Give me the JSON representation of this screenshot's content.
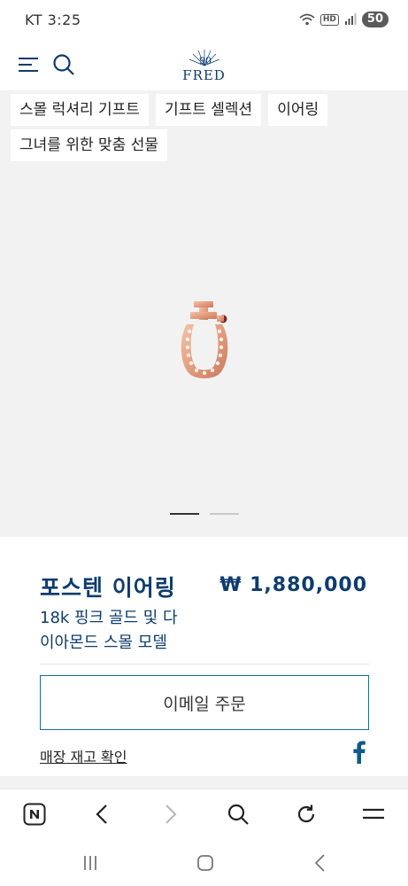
{
  "status_bar": {
    "time": "KT 3:25",
    "network_label": "HD",
    "battery": "50"
  },
  "header": {
    "logo_text": "FRED",
    "logo_mark": "90"
  },
  "tags": [
    "스몰 럭셔리 기프트",
    "기프트 셀렉션",
    "이어링",
    "그녀를 위한 맞춤 선물"
  ],
  "gallery": {
    "active_slide": 1,
    "total_slides": 2
  },
  "product": {
    "title": "포스텐 이어링",
    "price": "₩ 1,880,000",
    "description_line1": "18k 핑크 골드 및 다",
    "description_line2": "이아몬드 스몰 모델",
    "email_order_label": "이메일 주문",
    "stock_link_label": "매장 재고 확인"
  },
  "colors": {
    "brand_navy": "#0e3c6e",
    "button_border": "#1c6d87",
    "hero_bg": "#f2f2f2",
    "rose_gold": "#e8a888"
  },
  "icons": {
    "menu": "hamburger-menu-icon",
    "search": "search-icon",
    "facebook": "facebook-icon",
    "browser_home": "naver-n-icon",
    "back": "chevron-left-icon",
    "forward": "chevron-right-icon",
    "browser_search": "search-icon",
    "refresh": "refresh-icon",
    "browser_menu": "menu-lines-icon"
  }
}
